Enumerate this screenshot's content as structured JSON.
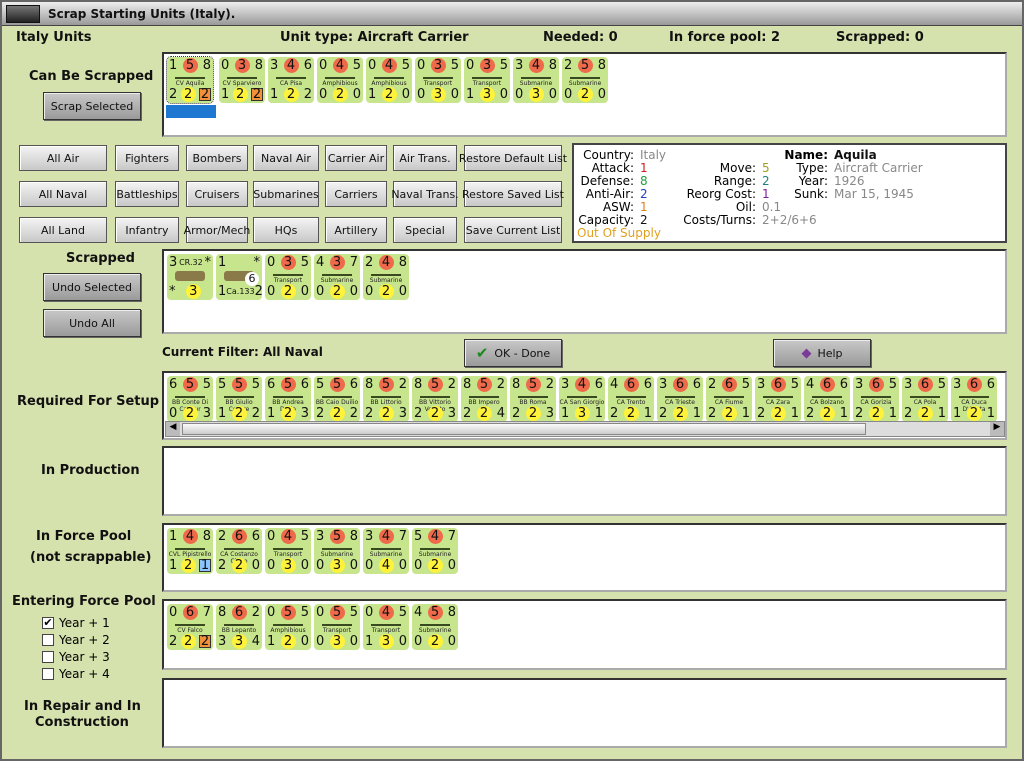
{
  "window": {
    "title": "Scrap Starting Units (Italy)."
  },
  "header": {
    "country_units": "Italy Units",
    "unit_type": "Unit type: Aircraft Carrier",
    "needed": "Needed:  0",
    "in_force_pool": "In force pool:  2",
    "scrapped": "Scrapped:  0"
  },
  "sections": {
    "can_be_scrapped": "Can Be Scrapped",
    "scrapped": "Scrapped",
    "current_filter": "Current Filter:  All Naval",
    "required": "Required For Setup",
    "production": "In Production",
    "force_pool": "In Force Pool",
    "not_scrappable": "(not scrappable)",
    "entering": "Entering Force Pool",
    "repair1": "In Repair and In",
    "repair2": "Construction"
  },
  "buttons": {
    "scrap_selected": "Scrap Selected",
    "undo_selected": "Undo Selected",
    "undo_all": "Undo All",
    "ok": "OK - Done",
    "help": "Help"
  },
  "filters": [
    [
      "All Air",
      "Fighters",
      "Bombers",
      "Naval Air",
      "Carrier Air",
      "Air Trans.",
      "Restore Default List"
    ],
    [
      "All Naval",
      "Battleships",
      "Cruisers",
      "Submarines",
      "Carriers",
      "Naval Trans.",
      "Restore Saved List"
    ],
    [
      "All Land",
      "Infantry",
      "Armor/Mech",
      "HQs",
      "Artillery",
      "Special",
      "Save Current List"
    ]
  ],
  "info": {
    "country": "Italy",
    "attack": "1",
    "defense": "8",
    "anti_air": "2",
    "asw": "1",
    "capacity": "2",
    "supply": "Out Of Supply",
    "move": "5",
    "range": "2",
    "reorg": "1",
    "oil": "0.1",
    "costs": "2+2/6+6",
    "name": "Aquila",
    "type": "Aircraft Carrier",
    "year": "1926",
    "sunk": "Mar 15, 1945",
    "labels": {
      "country": "Country:",
      "attack": "Attack:",
      "defense": "Defense:",
      "anti_air": "Anti-Air:",
      "asw": "ASW:",
      "capacity": "Capacity:",
      "move": "Move:",
      "range": "Range:",
      "reorg": "Reorg Cost:",
      "oil": "Oil:",
      "costs": "Costs/Turns:",
      "name": "Name:",
      "type": "Type:",
      "year": "Year:",
      "sunk": "Sunk:"
    }
  },
  "entering_years": [
    {
      "label": "Year + 1",
      "checked": true
    },
    {
      "label": "Year + 2",
      "checked": false
    },
    {
      "label": "Year + 3",
      "checked": false
    },
    {
      "label": "Year + 4",
      "checked": false
    }
  ],
  "colors": {
    "counter": "#c7e58c",
    "background": "#d6e2ae",
    "selection": "#1e78d2"
  },
  "units": {
    "can_be_scrapped": [
      {
        "t": [
          "1",
          "5",
          "8"
        ],
        "n": "CV Aquila",
        "b": [
          "2",
          "2",
          "2"
        ],
        "box": "o",
        "selected": true
      },
      {
        "t": [
          "0",
          "3",
          "8"
        ],
        "n": "CV Sparviero",
        "b": [
          "1",
          "2",
          "2"
        ],
        "box": "o"
      },
      {
        "t": [
          "3",
          "4",
          "6"
        ],
        "n": "CA Pisa",
        "b": [
          "1",
          "2",
          "2"
        ]
      },
      {
        "t": [
          "0",
          "4",
          "5"
        ],
        "n": "Amphibious",
        "b": [
          "0",
          "2",
          "0"
        ]
      },
      {
        "t": [
          "0",
          "4",
          "5"
        ],
        "n": "Amphibious",
        "b": [
          "1",
          "2",
          "0"
        ]
      },
      {
        "t": [
          "0",
          "3",
          "5"
        ],
        "n": "Transport",
        "b": [
          "0",
          "3",
          "0"
        ]
      },
      {
        "t": [
          "0",
          "3",
          "5"
        ],
        "n": "Transport",
        "b": [
          "1",
          "3",
          "0"
        ]
      },
      {
        "t": [
          "3",
          "4",
          "8"
        ],
        "n": "Submarine",
        "b": [
          "0",
          "3",
          "0"
        ]
      },
      {
        "t": [
          "2",
          "5",
          "8"
        ],
        "n": "Submarine",
        "b": [
          "0",
          "2",
          "0"
        ]
      }
    ],
    "scrapped": [
      {
        "t": [
          "3",
          "",
          "*"
        ],
        "n": "CR.32",
        "b": [
          "*",
          "3",
          ""
        ],
        "air": true
      },
      {
        "t": [
          "1",
          "",
          "*"
        ],
        "n": "",
        "b": [
          "1",
          "Ca.133",
          "2"
        ],
        "air": true,
        "badge": "6"
      },
      {
        "t": [
          "0",
          "3",
          "5"
        ],
        "n": "Transport",
        "b": [
          "0",
          "2",
          "0"
        ]
      },
      {
        "t": [
          "4",
          "3",
          "7"
        ],
        "n": "Submarine",
        "b": [
          "0",
          "2",
          "0"
        ]
      },
      {
        "t": [
          "2",
          "4",
          "8"
        ],
        "n": "Submarine",
        "b": [
          "0",
          "2",
          "0"
        ]
      }
    ],
    "required": [
      {
        "t": [
          "6",
          "5",
          "5"
        ],
        "n": "BB Conte Di Cavour",
        "b": [
          "0",
          "2",
          "3"
        ]
      },
      {
        "t": [
          "5",
          "5",
          "5"
        ],
        "n": "BB Giulio Cesare",
        "b": [
          "1",
          "2",
          "2"
        ]
      },
      {
        "t": [
          "6",
          "5",
          "6"
        ],
        "n": "BB Andrea Doria",
        "b": [
          "1",
          "2",
          "3"
        ]
      },
      {
        "t": [
          "5",
          "5",
          "6"
        ],
        "n": "BB Caio Duilio",
        "b": [
          "2",
          "2",
          "2"
        ]
      },
      {
        "t": [
          "8",
          "5",
          "2"
        ],
        "n": "BB Littorio",
        "b": [
          "2",
          "2",
          "3"
        ]
      },
      {
        "t": [
          "8",
          "5",
          "2"
        ],
        "n": "BB Vittorio Veneto",
        "b": [
          "2",
          "2",
          "3"
        ]
      },
      {
        "t": [
          "8",
          "5",
          "2"
        ],
        "n": "BB Impero",
        "b": [
          "2",
          "2",
          "4"
        ]
      },
      {
        "t": [
          "8",
          "5",
          "2"
        ],
        "n": "BB Roma",
        "b": [
          "2",
          "2",
          "3"
        ]
      },
      {
        "t": [
          "3",
          "4",
          "6"
        ],
        "n": "CA San Giorgio",
        "b": [
          "1",
          "3",
          "1"
        ]
      },
      {
        "t": [
          "4",
          "6",
          "6"
        ],
        "n": "CA Trento",
        "b": [
          "2",
          "2",
          "1"
        ]
      },
      {
        "t": [
          "3",
          "6",
          "6"
        ],
        "n": "CA Trieste",
        "b": [
          "2",
          "2",
          "1"
        ]
      },
      {
        "t": [
          "2",
          "6",
          "5"
        ],
        "n": "CA Fiume",
        "b": [
          "2",
          "2",
          "1"
        ]
      },
      {
        "t": [
          "3",
          "6",
          "5"
        ],
        "n": "CA Zara",
        "b": [
          "2",
          "2",
          "1"
        ]
      },
      {
        "t": [
          "4",
          "6",
          "6"
        ],
        "n": "CA Bolzano",
        "b": [
          "2",
          "2",
          "1"
        ]
      },
      {
        "t": [
          "3",
          "6",
          "5"
        ],
        "n": "CA Gorizia",
        "b": [
          "2",
          "2",
          "1"
        ]
      },
      {
        "t": [
          "3",
          "6",
          "5"
        ],
        "n": "CA Pola",
        "b": [
          "2",
          "2",
          "1"
        ]
      },
      {
        "t": [
          "3",
          "6",
          "6"
        ],
        "n": "CA Duca D'Aosta",
        "b": [
          "1",
          "2",
          "1"
        ]
      }
    ],
    "force_pool": [
      {
        "t": [
          "1",
          "4",
          "8"
        ],
        "n": "CVL Pipistrello",
        "b": [
          "1",
          "2",
          "1"
        ],
        "box": "b"
      },
      {
        "t": [
          "2",
          "6",
          "6"
        ],
        "n": "CA Costanzo Ciano",
        "b": [
          "2",
          "2",
          "0"
        ]
      },
      {
        "t": [
          "0",
          "4",
          "5"
        ],
        "n": "Transport",
        "b": [
          "0",
          "3",
          "0"
        ]
      },
      {
        "t": [
          "3",
          "5",
          "8"
        ],
        "n": "Submarine",
        "b": [
          "0",
          "3",
          "0"
        ]
      },
      {
        "t": [
          "3",
          "4",
          "7"
        ],
        "n": "Submarine",
        "b": [
          "0",
          "4",
          "0"
        ]
      },
      {
        "t": [
          "5",
          "4",
          "7"
        ],
        "n": "Submarine",
        "b": [
          "0",
          "2",
          "0"
        ]
      }
    ],
    "entering": [
      {
        "t": [
          "0",
          "6",
          "7"
        ],
        "n": "CV Falco",
        "b": [
          "2",
          "2",
          "2"
        ],
        "box": "o"
      },
      {
        "t": [
          "8",
          "6",
          "2"
        ],
        "n": "BB Lepanto",
        "b": [
          "3",
          "3",
          "4"
        ]
      },
      {
        "t": [
          "0",
          "5",
          "5"
        ],
        "n": "Amphibious",
        "b": [
          "1",
          "2",
          "0"
        ]
      },
      {
        "t": [
          "0",
          "5",
          "5"
        ],
        "n": "Transport",
        "b": [
          "0",
          "3",
          "0"
        ]
      },
      {
        "t": [
          "0",
          "4",
          "5"
        ],
        "n": "Transport",
        "b": [
          "1",
          "3",
          "0"
        ]
      },
      {
        "t": [
          "4",
          "5",
          "8"
        ],
        "n": "Submarine",
        "b": [
          "0",
          "2",
          "0"
        ]
      }
    ]
  }
}
